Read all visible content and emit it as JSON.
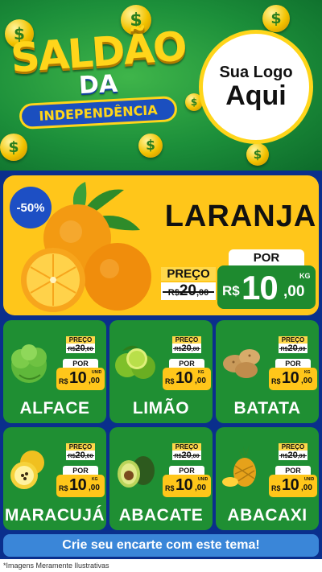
{
  "header": {
    "title_line1": "SALDÃO",
    "title_line2": "DA",
    "title_line3": "INDEPENDÊNCIA",
    "logo_line1": "Sua Logo",
    "logo_line2": "Aqui",
    "coin_symbol": "$"
  },
  "featured": {
    "discount": "-50%",
    "name": "LARANJA",
    "preco_label": "PREÇO",
    "old_prefix": "R$",
    "old_int": "20",
    "old_cents": ",00",
    "por_label": "POR",
    "currency": "R$",
    "price_int": "10",
    "price_cents": ",00",
    "unit": "KG"
  },
  "products": [
    {
      "name": "ALFACE",
      "preco_label": "PREÇO",
      "old_prefix": "R$",
      "old_int": "20",
      "old_cents": ",00",
      "por_label": "POR",
      "currency": "R$",
      "price_int": "10",
      "price_cents": ",00",
      "unit": "UNID"
    },
    {
      "name": "LIMÃO",
      "preco_label": "PREÇO",
      "old_prefix": "R$",
      "old_int": "20",
      "old_cents": ",00",
      "por_label": "POR",
      "currency": "R$",
      "price_int": "10",
      "price_cents": ",00",
      "unit": "KG"
    },
    {
      "name": "BATATA",
      "preco_label": "PREÇO",
      "old_prefix": "R$",
      "old_int": "20",
      "old_cents": ",00",
      "por_label": "POR",
      "currency": "R$",
      "price_int": "10",
      "price_cents": ",00",
      "unit": "KG"
    },
    {
      "name": "MARACUJÁ",
      "preco_label": "PREÇO",
      "old_prefix": "R$",
      "old_int": "20",
      "old_cents": ",00",
      "por_label": "POR",
      "currency": "R$",
      "price_int": "10",
      "price_cents": ",00",
      "unit": "KG"
    },
    {
      "name": "ABACATE",
      "preco_label": "PREÇO",
      "old_prefix": "R$",
      "old_int": "20",
      "old_cents": ",00",
      "por_label": "POR",
      "currency": "R$",
      "price_int": "10",
      "price_cents": ",00",
      "unit": "UNID"
    },
    {
      "name": "ABACAXI",
      "preco_label": "PREÇO",
      "old_prefix": "R$",
      "old_int": "20",
      "old_cents": ",00",
      "por_label": "POR",
      "currency": "R$",
      "price_int": "10",
      "price_cents": ",00",
      "unit": "UNID"
    }
  ],
  "cta": "Crie seu encarte com este tema!",
  "footnote": "*Imagens Meramente Ilustrativas",
  "colors": {
    "brand_blue": "#0a2f8c",
    "accent_yellow": "#ffc61a",
    "card_green": "#1f8f33",
    "cta_blue": "#3a86d8"
  }
}
